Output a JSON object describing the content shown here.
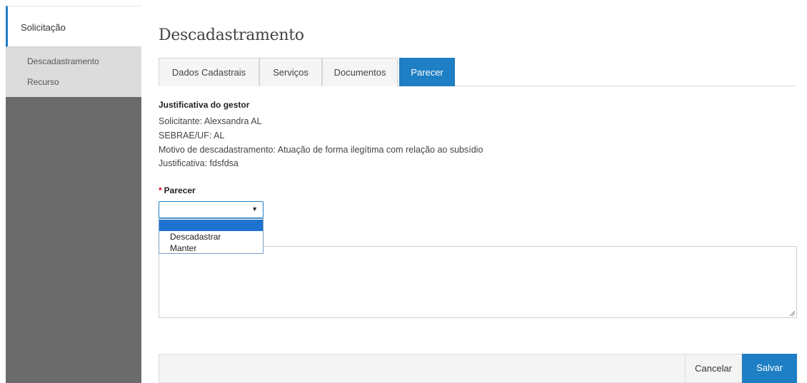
{
  "sidebar": {
    "header": "Solicitação",
    "items": [
      {
        "label": "Descadastramento"
      },
      {
        "label": "Recurso"
      }
    ]
  },
  "page": {
    "title": "Descadastramento"
  },
  "tabs": [
    {
      "label": "Dados Cadastrais",
      "active": false
    },
    {
      "label": "Serviços",
      "active": false
    },
    {
      "label": "Documentos",
      "active": false
    },
    {
      "label": "Parecer",
      "active": true
    }
  ],
  "justification": {
    "title": "Justificativa do gestor",
    "lines": [
      "Solicitante: Alexsandra AL",
      "SEBRAE/UF: AL",
      "Motivo de descadastramento: Atuação de forma ilegítima com relação ao subsídio",
      "Justificativa: fdsfdsa"
    ]
  },
  "parecer": {
    "required_mark": "*",
    "label": "Parecer",
    "selected_value": "",
    "options": [
      "",
      "Descadastrar",
      "Manter"
    ]
  },
  "actions": {
    "cancel_label": "Cancelar",
    "save_label": "Salvar"
  },
  "colors": {
    "accent": "#1f7fc4",
    "sidebar_dark": "#6b6b6b",
    "sidebar_light": "#dcdcdc",
    "required": "#d0021b"
  },
  "icons": {
    "select_arrow": "caret-down-icon",
    "resize": "resize-grip-icon"
  }
}
